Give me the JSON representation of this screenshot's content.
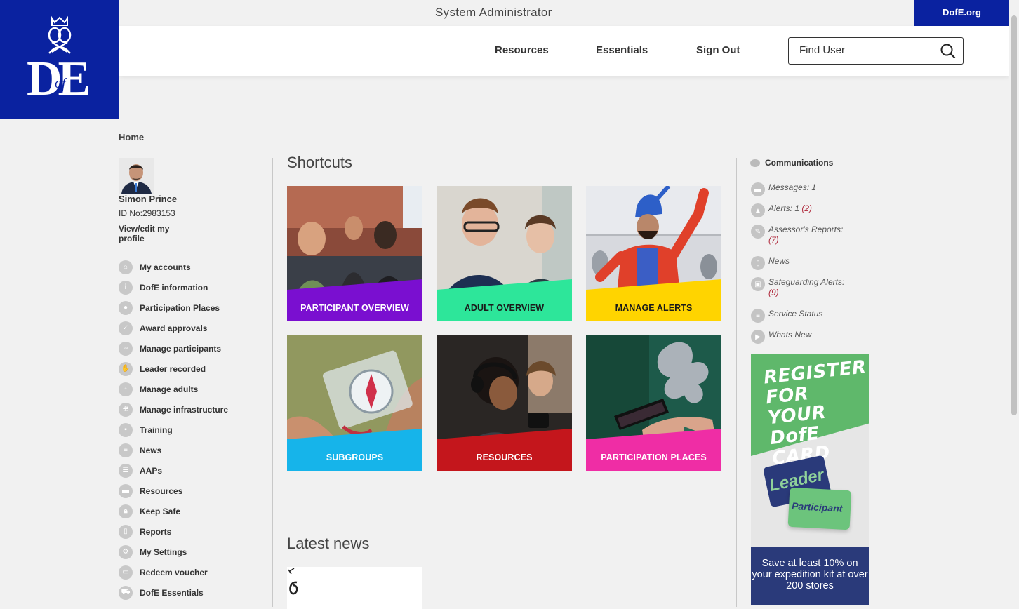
{
  "header": {
    "role": "System Administrator",
    "external_link": "DofE.org",
    "nav": [
      "Resources",
      "Essentials",
      "Sign Out"
    ],
    "search_placeholder": "Find User"
  },
  "logo": {
    "text": "DE",
    "of": "of"
  },
  "breadcrumb": "Home",
  "profile": {
    "name": "Simon Prince",
    "id": "ID No:2983153",
    "edit_link": "View/edit my profile"
  },
  "sidebar_menu": [
    {
      "label": "My accounts",
      "icon": "home-icon"
    },
    {
      "label": "DofE information",
      "icon": "info-icon"
    },
    {
      "label": "Participation Places",
      "icon": "person-icon"
    },
    {
      "label": "Award approvals",
      "icon": "shield-check-icon"
    },
    {
      "label": "Manage participants",
      "icon": "people-icon"
    },
    {
      "label": "Leader recorded",
      "icon": "hand-icon"
    },
    {
      "label": "Manage adults",
      "icon": "adults-icon"
    },
    {
      "label": "Manage infrastructure",
      "icon": "network-icon"
    },
    {
      "label": "Training",
      "icon": "training-icon"
    },
    {
      "label": "News",
      "icon": "news-icon"
    },
    {
      "label": "AAPs",
      "icon": "list-icon"
    },
    {
      "label": "Resources",
      "icon": "folder-icon"
    },
    {
      "label": "Keep Safe",
      "icon": "lock-icon"
    },
    {
      "label": "Reports",
      "icon": "document-icon"
    },
    {
      "label": "My Settings",
      "icon": "gear-icon"
    },
    {
      "label": "Redeem voucher",
      "icon": "voucher-icon"
    },
    {
      "label": "DofE Essentials",
      "icon": "cart-icon"
    }
  ],
  "main": {
    "shortcuts_title": "Shortcuts",
    "tiles": [
      {
        "label": "PARTICIPANT OVERVIEW",
        "color": "#7a0fd0",
        "text_color": "#ffffff"
      },
      {
        "label": "ADULT OVERVIEW",
        "color": "#2de69a",
        "text_color": "#1a1a1a"
      },
      {
        "label": "MANAGE ALERTS",
        "color": "#ffd400",
        "text_color": "#1a1a1a"
      },
      {
        "label": "SUBGROUPS",
        "color": "#16b4ea",
        "text_color": "#ffffff"
      },
      {
        "label": "RESOURCES",
        "color": "#c4161c",
        "text_color": "#ffffff"
      },
      {
        "label": "PARTICIPATION PLACES",
        "color": "#ef2da5",
        "text_color": "#ffffff"
      }
    ],
    "news_title": "Latest news"
  },
  "communications": {
    "title": "Communications",
    "items": [
      {
        "label": "Messages:",
        "count": "1",
        "extra": "",
        "icon": "message-icon"
      },
      {
        "label": "Alerts:",
        "count": "1",
        "extra": "(2)",
        "icon": "alert-icon"
      },
      {
        "label": "Assessor's Reports:",
        "count": "",
        "extra": "(7)",
        "icon": "report-icon"
      },
      {
        "label": "News",
        "count": "",
        "extra": "",
        "icon": "news-icon"
      },
      {
        "label": "Safeguarding Alerts:",
        "count": "",
        "extra": "(9)",
        "icon": "lock-icon"
      },
      {
        "label": "Service Status",
        "count": "",
        "extra": "",
        "icon": "status-icon"
      },
      {
        "label": "Whats New",
        "count": "",
        "extra": "",
        "icon": "play-icon"
      }
    ]
  },
  "ad": {
    "headline": "REGISTER FOR YOUR DofE CARD",
    "card_leader": "Leader",
    "card_participant": "Participant",
    "promo": "Save at least 10% on your expedition kit at over 200 stores"
  }
}
